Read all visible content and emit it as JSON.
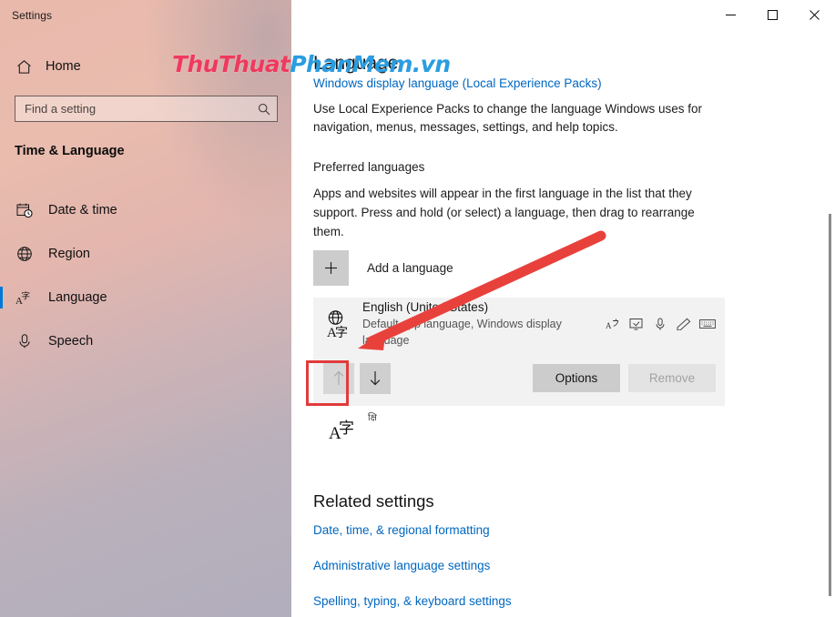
{
  "window": {
    "app_title": "Settings",
    "controls": [
      {
        "name": "minimize",
        "glyph": "minimize-icon"
      },
      {
        "name": "maximize",
        "glyph": "maximize-icon"
      },
      {
        "name": "close",
        "glyph": "close-icon"
      }
    ]
  },
  "sidebar": {
    "home_label": "Home",
    "home_icon": "home-icon",
    "search": {
      "placeholder": "Find a setting",
      "value": "",
      "icon": "search-icon"
    },
    "category": "Time & Language",
    "items": [
      {
        "label": "Date & time",
        "icon": "calendar-clock-icon",
        "selected": false
      },
      {
        "label": "Region",
        "icon": "globe-icon",
        "selected": false
      },
      {
        "label": "Language",
        "icon": "language-icon",
        "selected": true
      },
      {
        "label": "Speech",
        "icon": "microphone-icon",
        "selected": false
      }
    ],
    "accent_color": "#0078d7"
  },
  "main": {
    "heading": "Language",
    "lep_link": "Windows display language (Local Experience Packs)",
    "lep_description": "Use Local Experience Packs to change the language Windows uses for navigation, menus, messages, settings, and help topics.",
    "preferred": {
      "title": "Preferred languages",
      "description": "Apps and websites will appear in the first language in the list that they support. Press and hold (or select) a language, then drag to rearrange them."
    },
    "add_language": {
      "label": "Add a language",
      "icon": "plus-icon"
    },
    "language_card": {
      "icon": "language-globe-icon",
      "name": "English (United States)",
      "subtitle": "Default app language, Windows display language",
      "feature_icons": [
        "text-translate-icon",
        "display-language-icon",
        "speech-microphone-icon",
        "handwriting-pen-icon",
        "keyboard-icon"
      ],
      "move_up": {
        "label": "Move up",
        "icon": "arrow-up-icon",
        "enabled": false
      },
      "move_down": {
        "label": "Move down",
        "icon": "arrow-down-icon",
        "enabled": true
      },
      "options_button": {
        "label": "Options",
        "enabled": true
      },
      "remove_button": {
        "label": "Remove",
        "enabled": false
      }
    },
    "second_language": {
      "icon": "language-globe-icon",
      "secondary_icon": "language-glyph-icon"
    },
    "related": {
      "title": "Related settings",
      "links": [
        "Date, time, & regional formatting",
        "Administrative language settings",
        "Spelling, typing, & keyboard settings"
      ]
    },
    "link_color": "#0067c0"
  },
  "scrollbar": {
    "orientation": "vertical",
    "thumb_top_pct": 31,
    "thumb_height_pct": 65
  },
  "annotation": {
    "arrow_color": "#e8413c",
    "highlight_color": "#e23b3b",
    "arrow_label": "red-pointer-arrow",
    "highlight_target": "move-up-button"
  },
  "watermark": {
    "part_a": "ThuThuat",
    "part_b": "PhanMem.vn",
    "color_a": "#ee3a5e",
    "color_b": "#2a9de0"
  }
}
